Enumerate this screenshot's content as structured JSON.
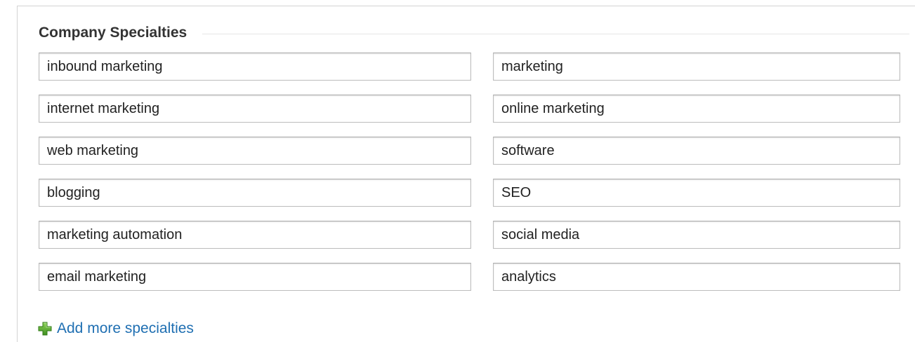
{
  "section": {
    "title": "Company Specialties"
  },
  "specialties": {
    "left": [
      "inbound marketing",
      "internet marketing",
      "web marketing",
      "blogging",
      "marketing automation",
      "email marketing"
    ],
    "right": [
      "marketing",
      "online marketing",
      "software",
      "SEO",
      "social media",
      "analytics"
    ]
  },
  "add_more": {
    "label": "Add more specialties",
    "icon": "plus-icon"
  },
  "colors": {
    "link": "#1f6fb2",
    "icon_green": "#5aa531"
  }
}
